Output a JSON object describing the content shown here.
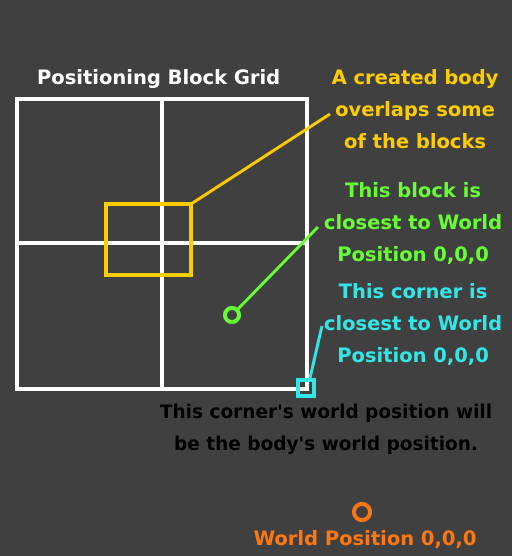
{
  "grid_title": "Positioning Block Grid",
  "body_label": [
    "A created body",
    "overlaps some",
    "of the blocks"
  ],
  "block_label": [
    "This block is",
    "closest to World",
    "Position 0,0,0"
  ],
  "corner_label": [
    "This corner is",
    "closest to World",
    "Position 0,0,0"
  ],
  "note_label": [
    "This corner's world position will",
    "be the body's world position."
  ],
  "origin_label": "World Position 0,0,0",
  "colors": {
    "background": "#404040",
    "grid": "#ffffff",
    "body": "#ffcc00",
    "block": "#66ff33",
    "corner": "#33e6e6",
    "note": "#000000",
    "origin": "#ff7711",
    "title": "#ffffff"
  }
}
